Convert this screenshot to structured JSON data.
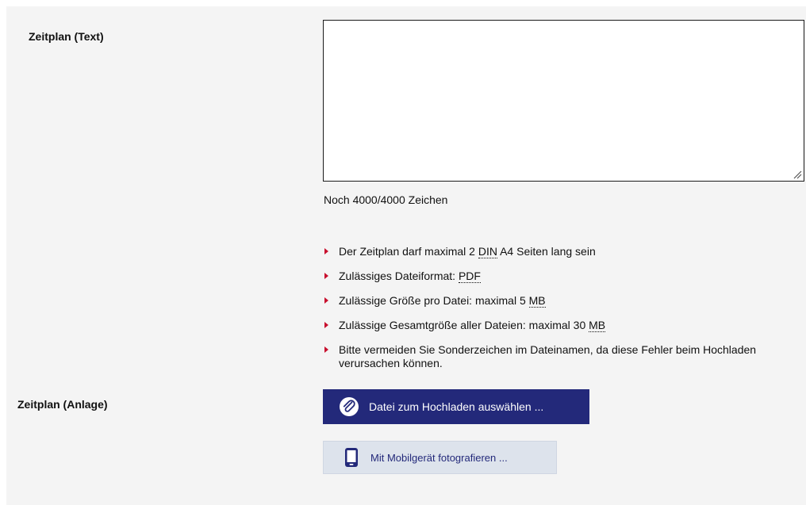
{
  "form": {
    "text_field": {
      "label": "Zeitplan (Text)",
      "value": "",
      "counter": "Noch 4000/4000 Zeichen"
    },
    "hints": [
      {
        "before": "Der Zeitplan darf maximal 2 ",
        "abbr": "DIN",
        "after": " A4 Seiten lang sein"
      },
      {
        "before": "Zulässiges Dateiformat: ",
        "abbr": "PDF",
        "after": ""
      },
      {
        "before": "Zulässige Größe pro Datei: maximal 5 ",
        "abbr": "MB",
        "after": ""
      },
      {
        "before": "Zulässige Gesamtgröße aller Dateien: maximal 30 ",
        "abbr": "MB",
        "after": ""
      },
      {
        "before": "Bitte vermeiden Sie Sonderzeichen im Dateinamen, da diese Fehler beim Hochladen verursachen können.",
        "abbr": "",
        "after": ""
      }
    ],
    "attachment": {
      "label": "Zeitplan (Anlage)",
      "upload_button_label": "Datei zum Hochladen auswählen ...",
      "mobile_button_label": "Mit Mobilgerät fotografieren ..."
    }
  },
  "colors": {
    "panel_background": "#f4f4f4",
    "primary_button": "#23297a",
    "secondary_button": "#dde3ec",
    "bullet": "#c8102e"
  },
  "icons": {
    "upload": "paperclip-icon",
    "mobile": "smartphone-icon",
    "bullet": "triangle-right-icon"
  }
}
